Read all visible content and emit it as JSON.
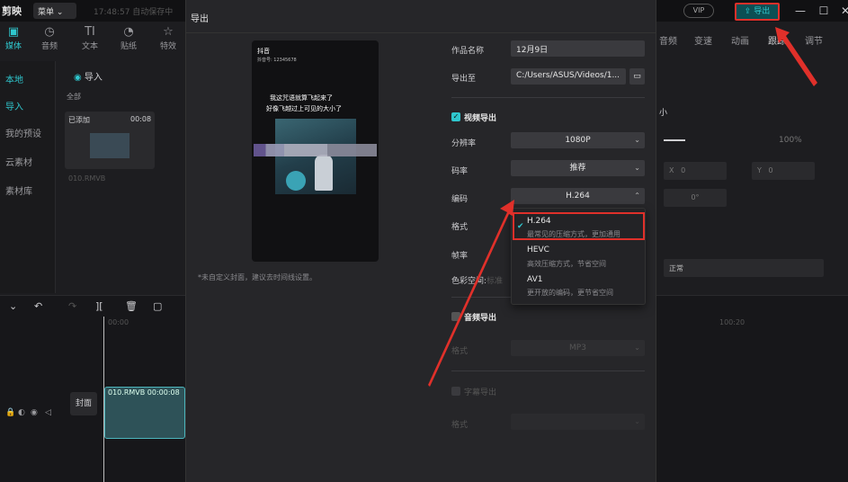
{
  "app": {
    "logo": "剪映",
    "menu_label": "菜单 ⌄",
    "save_status": "17:48:57 自动保存中",
    "vip_label": "VIP",
    "export_label": "导出",
    "window_controls": [
      "—",
      "☐",
      "✕"
    ]
  },
  "left_panel": {
    "tools": [
      {
        "icon": "media-icon",
        "label": "媒体"
      },
      {
        "icon": "audio-icon",
        "label": "音频"
      },
      {
        "icon": "text-icon",
        "label": "文本"
      },
      {
        "icon": "sticker-icon",
        "label": "贴纸"
      },
      {
        "icon": "effects-icon",
        "label": "特效"
      }
    ],
    "nav": [
      "本地",
      "导入",
      "我的预设",
      "云素材",
      "素材库"
    ],
    "import_label": "导入",
    "all_label": "全部",
    "media": {
      "added": "已添加",
      "duration": "00:08",
      "name": "010.RMVB"
    }
  },
  "right_panel": {
    "tabs": [
      "音频",
      "变速",
      "动画",
      "跟踪",
      "调节"
    ],
    "size_label": "小",
    "scale_value": "100%",
    "x_label": "X",
    "x_value": "0",
    "y_label": "Y",
    "y_value": "0",
    "rotate_value": "0°",
    "blend_value": "正常"
  },
  "timeline": {
    "tool_icons": [
      "⌄",
      "↶",
      "↷",
      "][",
      "🗑",
      "▢"
    ],
    "timecode_start": "00:00",
    "timecode_mid": "100:20",
    "clip_label": "010.RMVB  00:00:08",
    "cover_label": "封面"
  },
  "dialog": {
    "title": "导出",
    "preview": {
      "logo": "抖音",
      "sub": "抖音号: 12345678",
      "caption1": "我这咒语就算飞起来了",
      "caption2": "好像飞越过上可见的大小了"
    },
    "cover_note": "*未自定义封面，建议去时间线设置。",
    "fields": {
      "name_label": "作品名称",
      "name_value": "12月9日",
      "path_label": "导出至",
      "path_value": "C:/Users/ASUS/Videos/1...",
      "video_export_label": "视频导出",
      "resolution_label": "分辨率",
      "resolution_value": "1080P",
      "bitrate_label": "码率",
      "bitrate_value": "推荐",
      "codec_label": "编码",
      "codec_value": "H.264",
      "format_label": "格式",
      "fps_label": "帧率",
      "colorspace_label": "色彩空间:",
      "colorspace_value": "标准",
      "audio_export_label": "音频导出",
      "audio_format_label": "格式",
      "audio_format_value": "MP3",
      "subtitle_export_label": "字幕导出",
      "subtitle_format_label": "格式"
    },
    "codec_options": [
      {
        "title": "H.264",
        "desc": "最常见的压缩方式，更加通用"
      },
      {
        "title": "HEVC",
        "desc": "高效压缩方式，节省空间"
      },
      {
        "title": "AV1",
        "desc": "更开放的编码，更节省空间"
      }
    ]
  },
  "colors": {
    "accent": "#2fc7ce",
    "highlight_red": "#e0302a"
  }
}
